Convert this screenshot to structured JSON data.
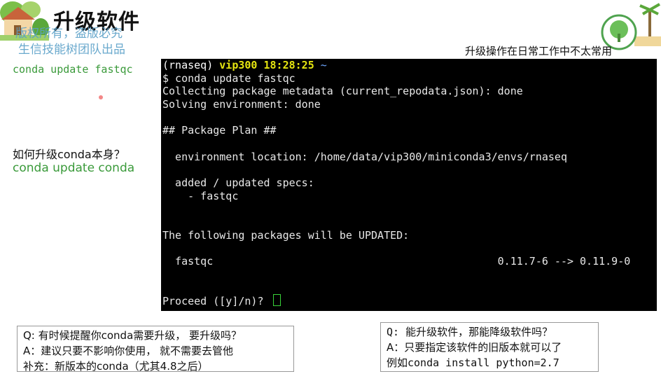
{
  "slide": {
    "title": "升级软件",
    "watermark_line1": "版权所有，盗版必究",
    "watermark_line2": "生信技能树团队出品",
    "right_note": "升级操作在日常工作中不太常用"
  },
  "left_panel": {
    "command": "conda update fastqc",
    "question": "如何升级conda本身？",
    "answer_command": "conda update conda"
  },
  "terminal": {
    "prompt_env": "(rnaseq)",
    "prompt_user": "vip300",
    "prompt_time": "18:28:25",
    "prompt_dir": "~",
    "lines": [
      "$ conda update fastqc",
      "Collecting package metadata (current_repodata.json): done",
      "Solving environment: done",
      "",
      "## Package Plan ##",
      "",
      "  environment location: /home/data/vip300/miniconda3/envs/rnaseq",
      "",
      "  added / updated specs:",
      "    - fastqc",
      "",
      "",
      "The following packages will be UPDATED:",
      "",
      "  fastqc                                             0.11.7-6 --> 0.11.9-0",
      "",
      "",
      "Proceed ([y]/n)? "
    ]
  },
  "box_left": {
    "line1": "Q: 有时候提醒你conda需要升级， 要升级吗？",
    "line2": "A：建议只要不影响你使用， 就不需要去管他",
    "line3": "补充：新版本的conda（尤其4.8之后）"
  },
  "box_right": {
    "line1": "Q: 能升级软件，那能降级软件吗？",
    "line2": "A：只要指定该软件的旧版本就可以了",
    "line3": "例如conda install python=2.7"
  }
}
